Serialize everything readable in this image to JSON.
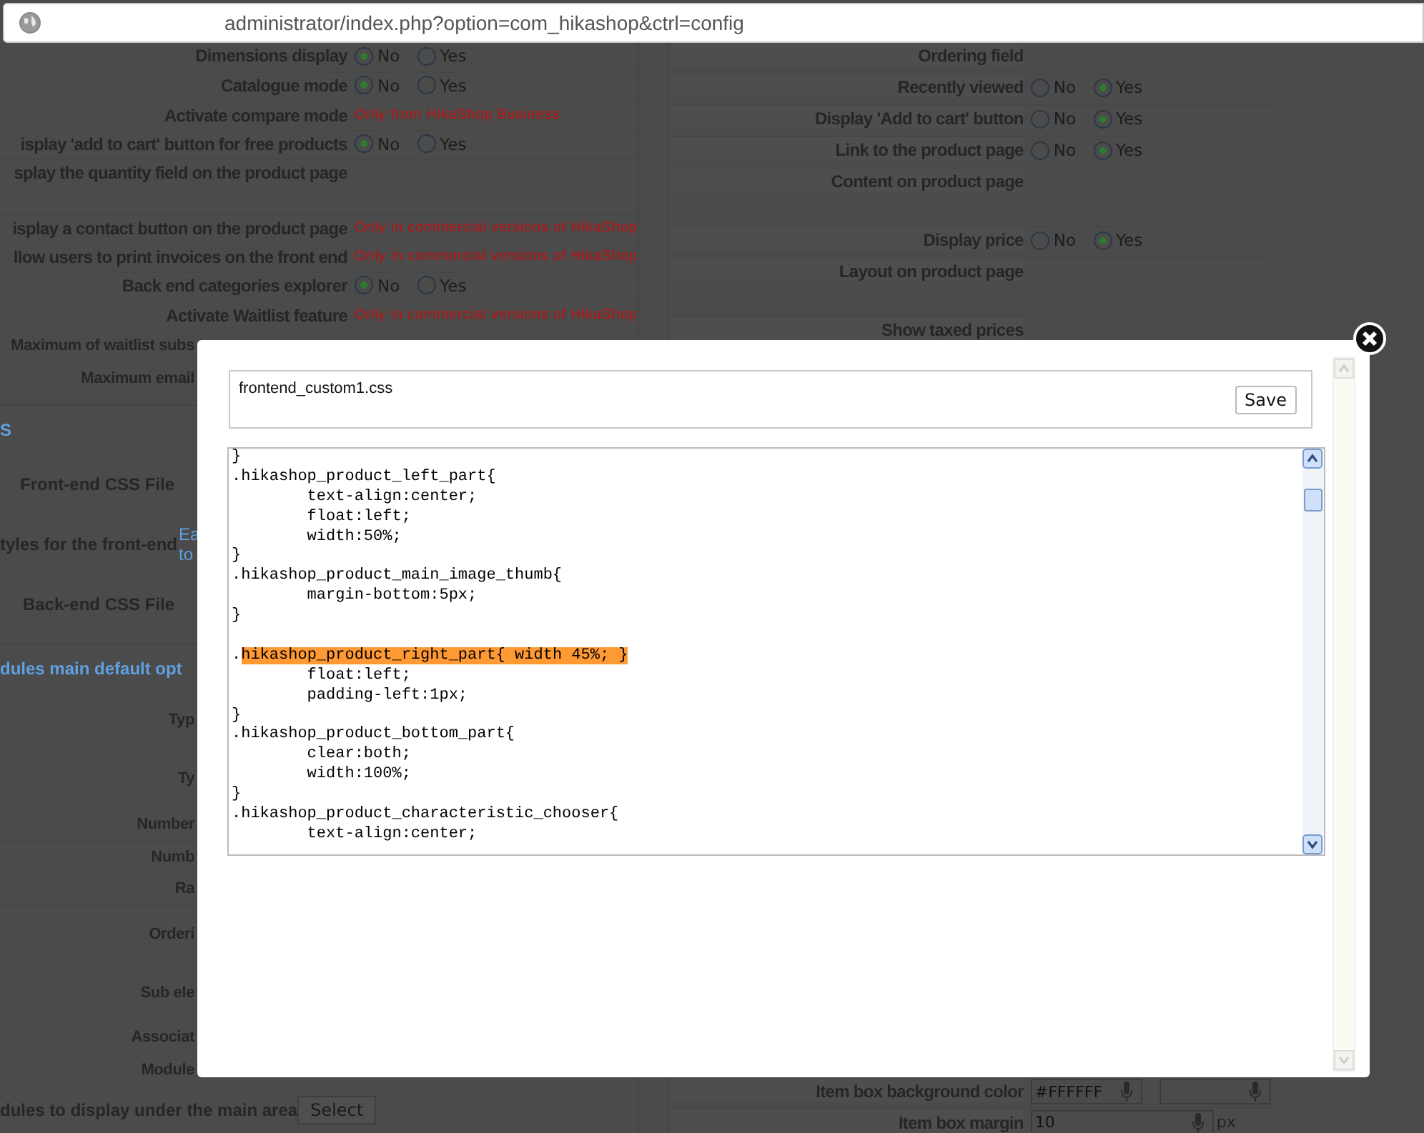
{
  "address_bar": {
    "url": "administrator/index.php?option=com_hikashop&ctrl=config"
  },
  "left_panel": {
    "rows": [
      {
        "kind": "radio",
        "label": "Dimensions display",
        "options": [
          {
            "label": "No",
            "selected": true
          },
          {
            "label": "Yes",
            "selected": false
          }
        ]
      },
      {
        "kind": "radio",
        "label": "Catalogue mode",
        "options": [
          {
            "label": "No",
            "selected": true
          },
          {
            "label": "Yes",
            "selected": false
          }
        ]
      },
      {
        "kind": "note",
        "label": "Activate compare mode",
        "note": "Only from HikaShop Business"
      },
      {
        "kind": "radio",
        "label": "isplay 'add to cart' button for free products",
        "options": [
          {
            "label": "No",
            "selected": true
          },
          {
            "label": "Yes",
            "selected": false
          }
        ]
      },
      {
        "kind": "tall",
        "label": "splay the quantity field on the product page"
      },
      {
        "kind": "note",
        "label": "isplay a contact button on the product page",
        "note": "Only in commercial versions of HikaShop"
      },
      {
        "kind": "note",
        "label": "llow users to print invoices on the front end",
        "note": "Only in commercial versions of HikaShop"
      },
      {
        "kind": "radio",
        "label": "Back end categories explorer",
        "options": [
          {
            "label": "No",
            "selected": true
          },
          {
            "label": "Yes",
            "selected": false
          }
        ]
      },
      {
        "kind": "note",
        "label": "Activate Waitlist feature",
        "note": "Only in commercial versions of HikaShop"
      }
    ],
    "covered_rows": [
      {
        "kind": "blank",
        "label": "Maximum of waitlist subs"
      },
      {
        "kind": "blank",
        "label": "Maximum email"
      }
    ],
    "css_section": {
      "title": "S",
      "rows": [
        {
          "label": "Front-end CSS File"
        },
        {
          "label": "tyles for the front-end",
          "description_lines": [
            "Ea",
            "to"
          ]
        },
        {
          "label": "Back-end CSS File"
        }
      ]
    },
    "modules_section": {
      "title": "dules main default opt",
      "rows": [
        {
          "kind": "tall",
          "label": "Typ"
        },
        {
          "kind": "tall",
          "label": "Ty"
        },
        {
          "kind": "blank",
          "label": "Number"
        },
        {
          "kind": "blank",
          "label": "Numb"
        },
        {
          "kind": "blank",
          "label": "Ra"
        },
        {
          "kind": "tall",
          "label": "Orderi"
        },
        {
          "kind": "tall",
          "label": "Sub ele"
        },
        {
          "kind": "blank",
          "label": "Associat"
        },
        {
          "kind": "blank",
          "label": "Module"
        }
      ]
    },
    "bottom_row": {
      "label": "dules to display under the main area",
      "button": "Select"
    }
  },
  "right_panel": {
    "rows": [
      {
        "kind": "blank",
        "label": "Ordering field"
      },
      {
        "kind": "radio",
        "label": "Recently viewed",
        "options": [
          {
            "label": "No",
            "selected": false
          },
          {
            "label": "Yes",
            "selected": true
          }
        ]
      },
      {
        "kind": "radio",
        "label": "Display 'Add to cart' button",
        "options": [
          {
            "label": "No",
            "selected": false
          },
          {
            "label": "Yes",
            "selected": true
          }
        ]
      },
      {
        "kind": "radio",
        "label": "Link to the product page",
        "options": [
          {
            "label": "No",
            "selected": false
          },
          {
            "label": "Yes",
            "selected": true
          }
        ]
      },
      {
        "kind": "tall",
        "label": "Content on product page"
      },
      {
        "kind": "radio",
        "label": "Display price",
        "options": [
          {
            "label": "No",
            "selected": false
          },
          {
            "label": "Yes",
            "selected": true
          }
        ]
      },
      {
        "kind": "tall",
        "label": "Layout on product page"
      },
      {
        "kind": "blank",
        "label": "Show taxed prices"
      }
    ],
    "bottom_rows": [
      {
        "kind": "color",
        "label": "Item box background color",
        "fields": [
          {
            "value": "#FFFFFF"
          }
        ]
      },
      {
        "kind": "size",
        "label": "Item box margin",
        "fields": [
          {
            "value": "10",
            "unit": "px"
          }
        ]
      }
    ]
  },
  "modal": {
    "filename": "frontend_custom1.css",
    "save_button": "Save",
    "code_lines": [
      {
        "text": "}"
      },
      {
        "text": ".hikashop_product_left_part{"
      },
      {
        "text": "        text-align:center;"
      },
      {
        "text": "        float:left;"
      },
      {
        "text": "        width:50%;"
      },
      {
        "text": "}"
      },
      {
        "text": ".hikashop_product_main_image_thumb{"
      },
      {
        "text": "        margin-bottom:5px;"
      },
      {
        "text": "}"
      },
      {
        "gap_before": true,
        "text": ".",
        "highlight": "hikashop_product_right_part{ width 45%; }"
      },
      {
        "text": "        float:left;"
      },
      {
        "text": "        padding-left:1px;"
      },
      {
        "text": "}"
      },
      {
        "text": ".hikashop_product_bottom_part{"
      },
      {
        "text": "        clear:both;"
      },
      {
        "text": "        width:100%;"
      },
      {
        "text": "}"
      },
      {
        "text": ".hikashop_product_characteristic_chooser{"
      },
      {
        "text": "        text-align:center;"
      }
    ]
  }
}
